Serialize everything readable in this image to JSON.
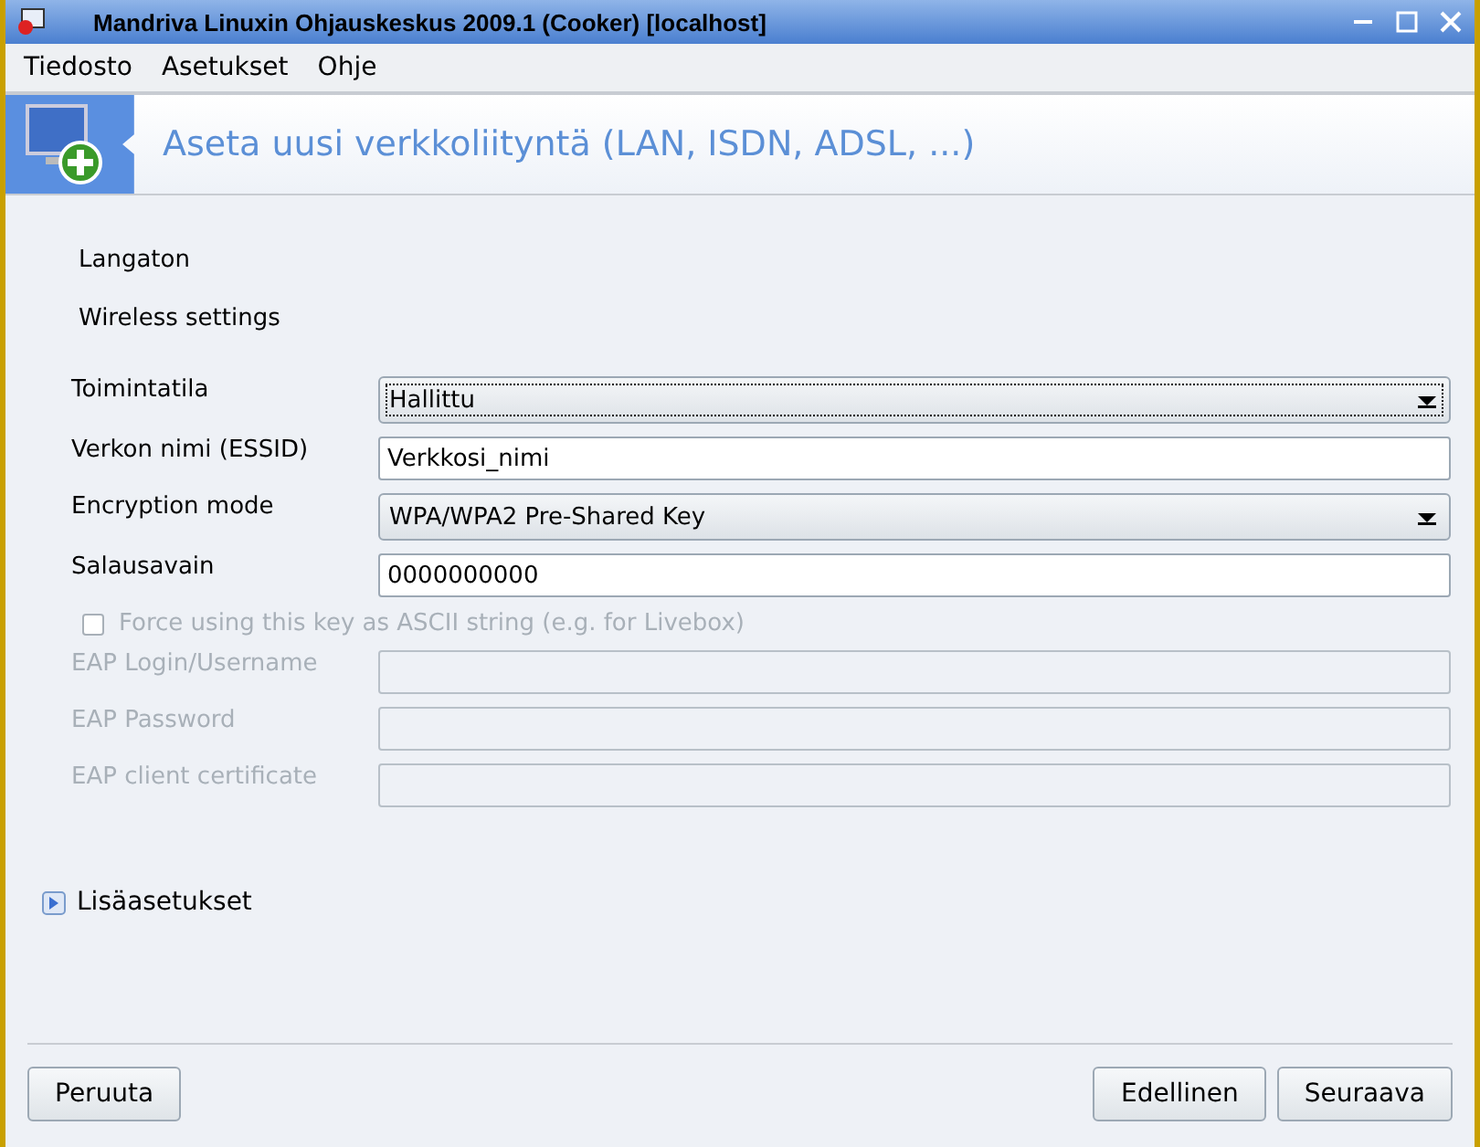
{
  "window": {
    "title": "Mandriva Linuxin Ohjauskeskus 2009.1 (Cooker) [localhost]"
  },
  "menu": [
    "Tiedosto",
    "Asetukset",
    "Ohje"
  ],
  "header": {
    "title": "Aseta uusi verkkoliityntä (LAN, ISDN, ADSL, ...)"
  },
  "section_labels": [
    "Langaton",
    "Wireless settings"
  ],
  "fields": [
    {
      "kind": "select",
      "label": "Toimintatila",
      "value": "Hallittu",
      "disabled": false,
      "focused": true
    },
    {
      "kind": "text",
      "label": "Verkon nimi (ESSID)",
      "value": "Verkkosi_nimi",
      "disabled": false
    },
    {
      "kind": "select",
      "label": "Encryption mode",
      "value": "WPA/WPA2 Pre-Shared Key",
      "disabled": false,
      "focused": false
    },
    {
      "kind": "text",
      "label": "Salausavain",
      "value": "0000000000",
      "disabled": false
    },
    {
      "kind": "checkbox",
      "label": "Force using this key as ASCII string (e.g. for Livebox)",
      "checked": false,
      "disabled": true
    },
    {
      "kind": "text",
      "label": "EAP Login/Username",
      "disabled": true
    },
    {
      "kind": "text",
      "label": "EAP Password",
      "disabled": true
    },
    {
      "kind": "text",
      "label": "EAP client certificate",
      "disabled": true
    }
  ],
  "expander": {
    "label": "Lisäasetukset",
    "expanded": false
  },
  "buttons_left": [
    "Peruuta"
  ],
  "buttons_right": [
    "Edellinen",
    "Seuraava"
  ]
}
